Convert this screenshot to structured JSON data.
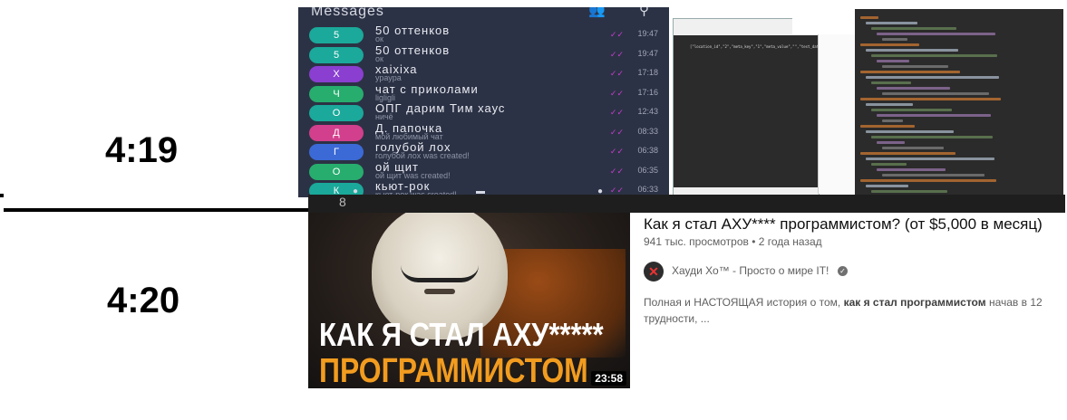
{
  "timeline": {
    "label_top": "4:19",
    "label_bottom": "4:20"
  },
  "messenger": {
    "title": "Messages",
    "chats": [
      {
        "name": "50 оттенков",
        "preview": "ок",
        "time": "19:47",
        "avatar": "5",
        "color": "#1aa99a"
      },
      {
        "name": "50 оттенков",
        "preview": "ок",
        "time": "19:47",
        "avatar": "5",
        "color": "#1aa99a"
      },
      {
        "name": "хаіхіха",
        "preview": "ураура",
        "time": "17:18",
        "avatar": "Х",
        "color": "#8a3fd1"
      },
      {
        "name": "чат с приколами",
        "preview": "ligligli",
        "time": "17:16",
        "avatar": "Ч",
        "color": "#27ad6e"
      },
      {
        "name": "ОПГ дарим Тим хаус",
        "preview": "ничё",
        "time": "12:43",
        "avatar": "О",
        "color": "#1aa99a"
      },
      {
        "name": "Д. папочка",
        "preview": "мой любимый чат",
        "time": "08:33",
        "avatar": "Д",
        "color": "#d23f8c"
      },
      {
        "name": "голубой лох",
        "preview": "голубой лох was created!",
        "time": "06:38",
        "avatar": "Г",
        "color": "#3b6ad6"
      },
      {
        "name": "ой щит",
        "preview": "ой щит was created!",
        "time": "06:35",
        "avatar": "О",
        "color": "#27ad6e"
      },
      {
        "name": "кьют-рок",
        "preview": "кьют-рок was created!",
        "time": "06:33",
        "avatar": "К",
        "color": "#1aa99a"
      }
    ]
  },
  "editor": {
    "code_line": "[\"location_id\",\"2\",\"meta_key\",\"1\",\"meta_value\",\"\",\"test_date\"]"
  },
  "video": {
    "title": "Как я стал АХУ**** программистом? (от $5,000 в месяц)",
    "views": "941 тыс. просмотров",
    "separator": " • ",
    "age": "2 года назад",
    "channel": "Хауди Хо™ - Просто о мире IT!",
    "channel_avatar": "✕",
    "verified_icon": "✓",
    "description_lead": "Полная и НАСТОЯЩАЯ история о том, ",
    "description_bold": "как я стал программистом",
    "description_tail": " начав в 12 трудности, ...",
    "thumbnail_line1": "КАК Я СТАЛ АХУ*****",
    "thumbnail_line2": "ПРОГРАММИСТОМ",
    "duration": "23:58",
    "accent_color": "#f29c1f"
  }
}
